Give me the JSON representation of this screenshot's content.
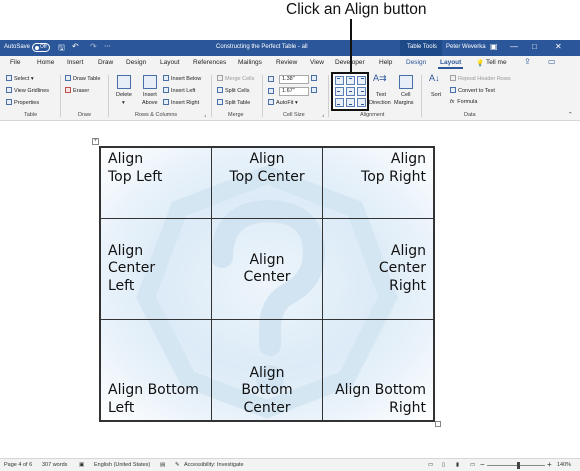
{
  "callout": {
    "text": "Click an Align button"
  },
  "titlebar": {
    "autosave_label": "AutoSave",
    "autosave_state": "Off",
    "doc_title": "Constructing the Perfect Table - all",
    "context_tab": "Table Tools",
    "user": "Peter Weverka",
    "window_buttons": [
      "—",
      "□",
      "✕"
    ]
  },
  "menu": {
    "items": [
      "File",
      "Home",
      "Insert",
      "Draw",
      "Design",
      "Layout",
      "References",
      "Mailings",
      "Review",
      "View",
      "Developer",
      "Help",
      "Design",
      "Layout"
    ],
    "tell_me": "Tell me",
    "active_index": 13
  },
  "ribbon": {
    "table": {
      "select": "Select",
      "view_gridlines": "View Gridlines",
      "properties": "Properties",
      "label": "Table"
    },
    "draw": {
      "draw_table": "Draw Table",
      "eraser": "Eraser",
      "label": "Draw"
    },
    "rows_cols": {
      "delete": "Delete",
      "insert_above_1": "Insert",
      "insert_above_2": "Above",
      "insert_below": "Insert Below",
      "insert_left": "Insert Left",
      "insert_right": "Insert Right",
      "label": "Rows & Columns"
    },
    "merge": {
      "merge_cells": "Merge Cells",
      "split_cells": "Split Cells",
      "split_table": "Split Table",
      "label": "Merge"
    },
    "cell_size": {
      "height": "1.38\"",
      "width": "1.67\"",
      "autofit": "AutoFit",
      "label": "Cell Size"
    },
    "alignment": {
      "text_direction_1": "Text",
      "text_direction_2": "Direction",
      "cell_margins_1": "Cell",
      "cell_margins_2": "Margins",
      "label": "Alignment"
    },
    "data": {
      "sort": "Sort",
      "repeat_header": "Repeat Header Rows",
      "convert": "Convert to Text",
      "formula": "Formula",
      "label": "Data"
    }
  },
  "table": {
    "cells": [
      "Align\nTop Left",
      "Align\nTop Center",
      "Align\nTop Right",
      "Align\nCenter\nLeft",
      "Align\nCenter",
      "Align\nCenter\nRight",
      "Align Bottom\nLeft",
      "Align\nBottom Center",
      "Align Bottom\nRight"
    ]
  },
  "status": {
    "page": "Page 4 of 6",
    "words": "307 words",
    "language": "English (United States)",
    "accessibility": "Accessibility: Investigate",
    "zoom": "140%",
    "zoom_level": 1.4
  }
}
